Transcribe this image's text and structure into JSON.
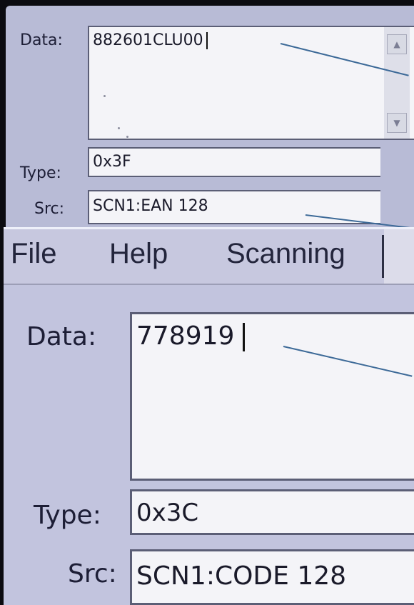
{
  "top_panel": {
    "data_label": "Data:",
    "data_value": "882601CLU00",
    "type_label": "Type:",
    "type_value": "0x3F",
    "src_label": "Src:",
    "src_value": "SCN1:EAN 128",
    "scroll_up_icon": "triangle-up",
    "scroll_down_icon": "triangle-down"
  },
  "menu": {
    "items": [
      "File",
      "Help",
      "Scanning"
    ]
  },
  "bottom_panel": {
    "data_label": "Data:",
    "data_value": "778919",
    "type_label": "Type:",
    "type_value": "0x3C",
    "src_label": "Src:",
    "src_value": "SCN1:CODE 128"
  },
  "colors": {
    "panel_bg": "#b8bbd6",
    "menu_bg": "#c7c8df",
    "field_bg": "#f4f4f8",
    "pointer_line": "#3d6a98"
  }
}
